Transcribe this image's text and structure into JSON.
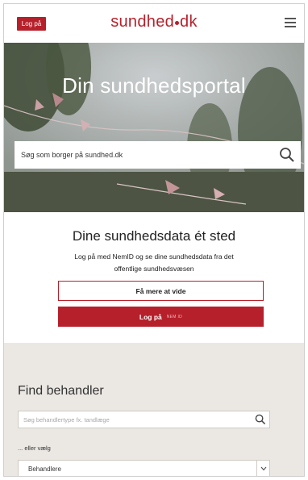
{
  "header": {
    "login_label": "Log på",
    "logo_left": "sundhed",
    "logo_right": "dk"
  },
  "hero": {
    "title": "Din sundhedsportal",
    "search_placeholder": "Søg som borger på sundhed.dk"
  },
  "data_section": {
    "title": "Dine sundhedsdata ét sted",
    "description": "Log på med NemID og se dine sundhedsdata fra det offentlige sundhedsvæsen",
    "more_button": "Få mere at vide",
    "login_button": "Log på",
    "login_tag": "NEM ID"
  },
  "find_section": {
    "title": "Find behandler",
    "search_placeholder": "Søg behandlertype fx. tandlæge",
    "or_label": "... eller vælg",
    "select_value": "Behandlere"
  },
  "colors": {
    "brand_red": "#b6202b",
    "find_background": "#ebe8e4"
  },
  "icons": [
    "menu-icon",
    "search-icon",
    "chevron-down-icon"
  ]
}
